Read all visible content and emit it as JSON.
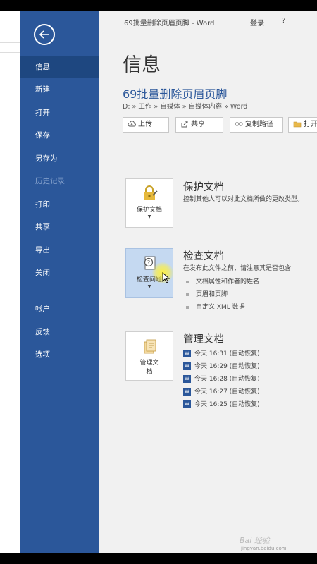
{
  "titlebar": {
    "doc_title": "69批量删除页眉页脚 - Word",
    "signin": "登录",
    "help": "?",
    "minimize": "—"
  },
  "sidebar": {
    "items": [
      {
        "label": "信息",
        "active": true
      },
      {
        "label": "新建"
      },
      {
        "label": "打开"
      },
      {
        "label": "保存"
      },
      {
        "label": "另存为"
      },
      {
        "label": "历史记录",
        "disabled": true
      },
      {
        "label": "打印"
      },
      {
        "label": "共享"
      },
      {
        "label": "导出"
      },
      {
        "label": "关闭"
      },
      {
        "label": "帐户"
      },
      {
        "label": "反馈"
      },
      {
        "label": "选项"
      }
    ]
  },
  "main": {
    "page_title": "信息",
    "doc_name": "69批量删除页眉页脚",
    "doc_path": "D: » 工作 » 自媒体 » 自媒体内容 » Word",
    "actions": {
      "upload": "上传",
      "share": "共享",
      "copy_path": "复制路径",
      "open": "打开"
    },
    "protect": {
      "tile_label": "保护文档",
      "heading": "保护文档",
      "desc": "控制其他人可以对此文档所做的更改类型。"
    },
    "inspect": {
      "tile_label": "检查问题",
      "heading": "检查文档",
      "desc": "在发布此文件之前，请注意其是否包含:",
      "bullets": [
        "文档属性和作者的姓名",
        "页眉和页脚",
        "自定义 XML 数据"
      ]
    },
    "manage": {
      "tile_label_1": "管理文",
      "tile_label_2": "档",
      "heading": "管理文档",
      "versions": [
        "今天 16:31 (自动恢复)",
        "今天 16:29 (自动恢复)",
        "今天 16:28 (自动恢复)",
        "今天 16:27 (自动恢复)",
        "今天 16:25 (自动恢复)"
      ]
    }
  },
  "watermark": {
    "text": "Bai 经验",
    "sub": "jingyan.baidu.com"
  },
  "colors": {
    "sidebar": "#2b579a",
    "sidebar_active": "#1e4780",
    "accent": "#2b579a",
    "main_bg": "#f1f1f1",
    "tile_hover": "#c5d9f1"
  }
}
